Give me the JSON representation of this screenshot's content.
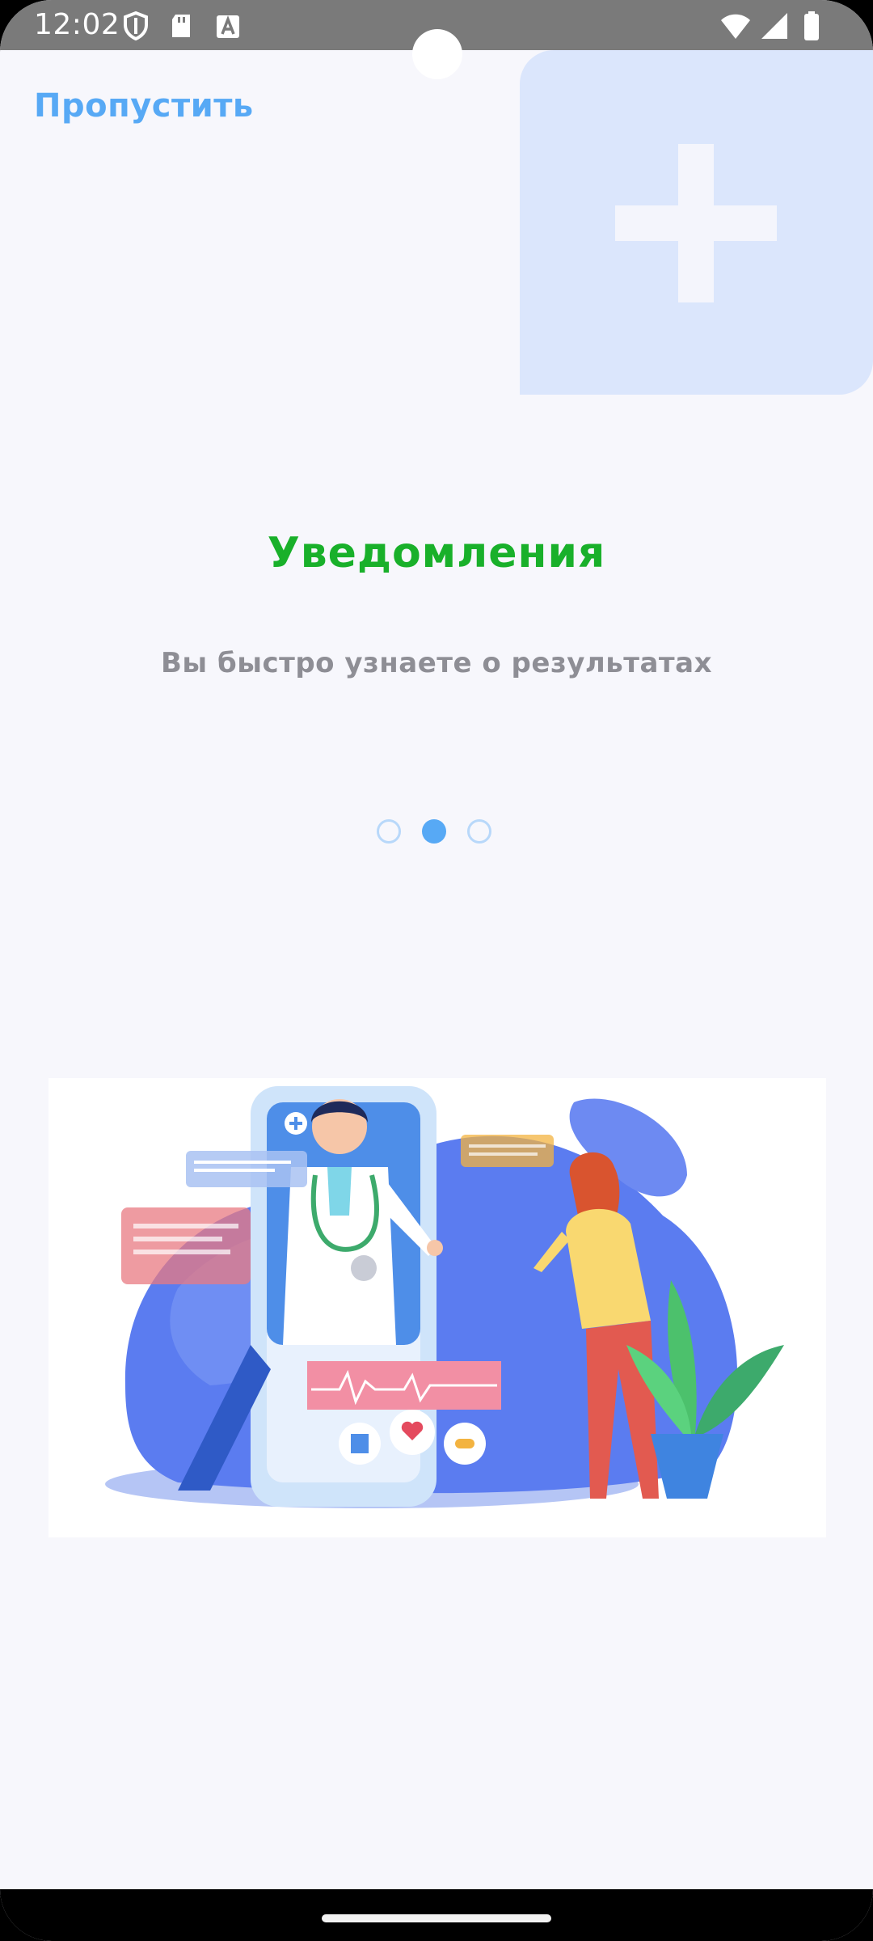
{
  "status_bar": {
    "time": "12:02",
    "icons": [
      "vpn-shield-icon",
      "sd-card-icon",
      "keyboard-a-icon",
      "wifi-icon",
      "signal-icon",
      "battery-icon"
    ]
  },
  "skip": {
    "label": "Пропустить"
  },
  "onboarding": {
    "title": "Уведомления",
    "subtitle": "Вы быстро узнаете о результатах",
    "page_index": 2,
    "page_count": 3
  },
  "colors": {
    "accent_blue": "#57A9F5",
    "title_green": "#19B02A",
    "subtitle_gray": "#8E8E95",
    "background": "#F7F7FC",
    "plus_card": "#DBE6FC"
  }
}
